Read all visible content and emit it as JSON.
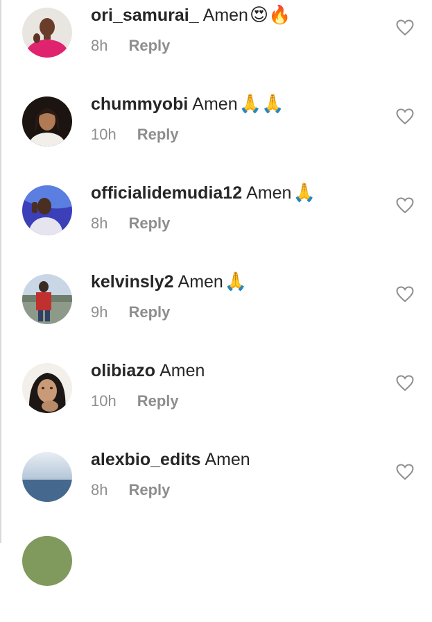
{
  "comments": [
    {
      "username": "ori_samurai_",
      "text": "Amen",
      "emojis": "😍🔥",
      "time": "8h",
      "reply_label": "Reply",
      "avatar_icon": "user-avatar-icon",
      "like_icon": "heart-outline-icon"
    },
    {
      "username": "chummyobi",
      "text": "Amen",
      "emojis": "🙏🙏",
      "time": "10h",
      "reply_label": "Reply",
      "avatar_icon": "user-avatar-icon",
      "like_icon": "heart-outline-icon"
    },
    {
      "username": "officialidemudia12",
      "text": "Amen",
      "emojis": "🙏",
      "time": "8h",
      "reply_label": "Reply",
      "avatar_icon": "user-avatar-icon",
      "like_icon": "heart-outline-icon"
    },
    {
      "username": "kelvinsly2",
      "text": "Amen",
      "emojis": "🙏",
      "time": "9h",
      "reply_label": "Reply",
      "avatar_icon": "user-avatar-icon",
      "like_icon": "heart-outline-icon"
    },
    {
      "username": "olibiazo",
      "text": "Amen",
      "emojis": "",
      "time": "10h",
      "reply_label": "Reply",
      "avatar_icon": "user-avatar-icon",
      "like_icon": "heart-outline-icon"
    },
    {
      "username": "alexbio_edits",
      "text": "Amen",
      "emojis": "",
      "time": "8h",
      "reply_label": "Reply",
      "avatar_icon": "user-avatar-icon",
      "like_icon": "heart-outline-icon"
    }
  ],
  "colors": {
    "text": "#262626",
    "secondary": "#8e8e8e",
    "background": "#ffffff"
  }
}
